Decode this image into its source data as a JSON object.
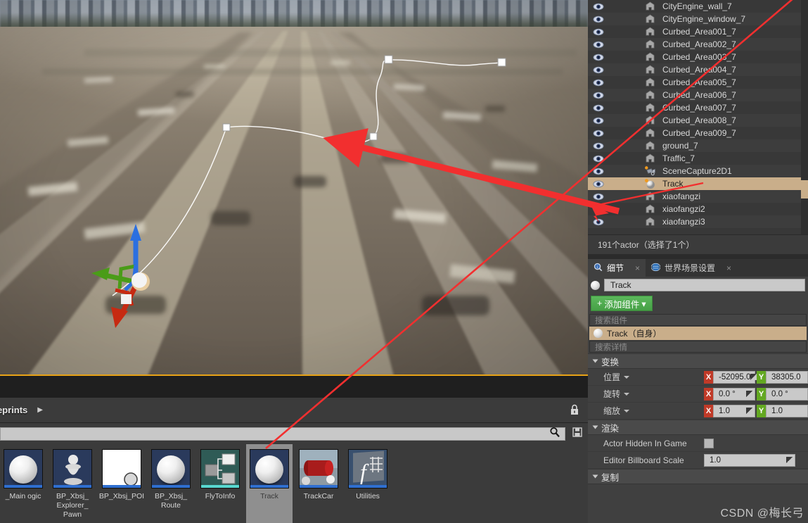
{
  "viewport": {
    "gizmo": {
      "name": "translate-gizmo",
      "axes": [
        "X",
        "Y",
        "Z"
      ]
    },
    "spline_points": 4,
    "selection_border_color": "#e8a317"
  },
  "bottom_toolbar": {
    "label": "ueprints",
    "arrow": "▶",
    "lock_icon": "lock-icon"
  },
  "content_browser": {
    "search_placeholder": "",
    "search_icon": "search-icon",
    "save_icon": "save-icon",
    "assets": [
      {
        "label": "_Main\nogic",
        "kind": "blueprint",
        "selected": false,
        "thumb": "sphere",
        "bg": "#2a3a5c",
        "stripe": "#2f6fd0"
      },
      {
        "label": "BP_Xbsj_\nExplorer_\nPawn",
        "kind": "blueprint",
        "selected": false,
        "thumb": "pawn",
        "bg": "#2a3a5c",
        "stripe": "#2f6fd0"
      },
      {
        "label": "BP_Xbsj_POI",
        "kind": "blueprint",
        "selected": false,
        "thumb": "white-sphere",
        "bg": "#ffffff",
        "stripe": "#2f6fd0"
      },
      {
        "label": "BP_Xbsj_\nRoute",
        "kind": "blueprint",
        "selected": false,
        "thumb": "sphere",
        "bg": "#2a3a5c",
        "stripe": "#2f6fd0"
      },
      {
        "label": "FlyToInfo",
        "kind": "struct",
        "selected": false,
        "thumb": "struct",
        "bg": "#2f5b56",
        "stripe": "#58d8d0"
      },
      {
        "label": "Track",
        "kind": "blueprint",
        "selected": true,
        "thumb": "sphere",
        "bg": "#2a3a5c",
        "stripe": "#2f6fd0"
      },
      {
        "label": "TrackCar",
        "kind": "blueprint",
        "selected": false,
        "thumb": "car",
        "bg": "#8c9aa6",
        "stripe": "#2f6fd0"
      },
      {
        "label": "Utilities",
        "kind": "function-library",
        "selected": false,
        "thumb": "function",
        "bg": "#39506e",
        "stripe": "#2f6fd0"
      }
    ]
  },
  "outliner": {
    "scrollbar": {
      "name": "outliner-scrollbar",
      "thumb_color": "#c9ae8a"
    },
    "rows": [
      {
        "name": "CityEngine_wall_7",
        "icon": "mesh-icon",
        "eye": "eye-icon",
        "selected": false
      },
      {
        "name": "CityEngine_window_7",
        "icon": "mesh-icon",
        "eye": "eye-icon",
        "selected": false
      },
      {
        "name": "Curbed_Area001_7",
        "icon": "mesh-icon",
        "eye": "eye-icon",
        "selected": false
      },
      {
        "name": "Curbed_Area002_7",
        "icon": "mesh-icon",
        "eye": "eye-icon",
        "selected": false
      },
      {
        "name": "Curbed_Area003_7",
        "icon": "mesh-icon",
        "eye": "eye-icon",
        "selected": false
      },
      {
        "name": "Curbed_Area004_7",
        "icon": "mesh-icon",
        "eye": "eye-icon",
        "selected": false
      },
      {
        "name": "Curbed_Area005_7",
        "icon": "mesh-icon",
        "eye": "eye-icon",
        "selected": false
      },
      {
        "name": "Curbed_Area006_7",
        "icon": "mesh-icon",
        "eye": "eye-icon",
        "selected": false
      },
      {
        "name": "Curbed_Area007_7",
        "icon": "mesh-icon",
        "eye": "eye-icon",
        "selected": false
      },
      {
        "name": "Curbed_Area008_7",
        "icon": "mesh-icon",
        "eye": "eye-icon",
        "selected": false
      },
      {
        "name": "Curbed_Area009_7",
        "icon": "mesh-icon",
        "eye": "eye-icon",
        "selected": false
      },
      {
        "name": "ground_7",
        "icon": "mesh-icon",
        "eye": "eye-icon",
        "selected": false
      },
      {
        "name": "Traffic_7",
        "icon": "mesh-icon",
        "eye": "eye-icon",
        "selected": false
      },
      {
        "name": "SceneCapture2D1",
        "icon": "scene-capture-icon",
        "eye": "eye-icon",
        "selected": false
      },
      {
        "name": "Track",
        "icon": "blueprint-sphere-icon",
        "eye": "eye-icon",
        "selected": true
      },
      {
        "name": "xiaofangzi",
        "icon": "mesh-icon",
        "eye": "eye-icon",
        "selected": false
      },
      {
        "name": "xiaofangzi2",
        "icon": "mesh-icon",
        "eye": "eye-icon",
        "selected": false
      },
      {
        "name": "xiaofangzi3",
        "icon": "mesh-icon",
        "eye": "eye-icon",
        "selected": false
      }
    ],
    "status": "191个actor（选择了1个）"
  },
  "details": {
    "tabs": [
      {
        "label": "细节",
        "icon": "details-search-icon",
        "active": true,
        "close": "×"
      },
      {
        "label": "世界场景设置",
        "icon": "world-icon",
        "active": false,
        "close": "×"
      }
    ],
    "actor_name": "Track",
    "add_component_label": "添加组件",
    "add_component_caret": "▾",
    "component_search_placeholder": "搜索组件",
    "component_row": "Track（自身）",
    "details_search_placeholder": "搜索详情",
    "sections": [
      {
        "title": "变换",
        "rows": [
          {
            "label": "位置",
            "type": "vector",
            "x": "-52095.0",
            "y": "38305.0"
          },
          {
            "label": "旋转",
            "type": "vector",
            "x": "0.0 °",
            "y": "0.0 °"
          },
          {
            "label": "缩放",
            "type": "vector",
            "x": "1.0",
            "y": "1.0"
          }
        ]
      },
      {
        "title": "渲染",
        "rows": [
          {
            "label": "Actor Hidden In Game",
            "type": "checkbox",
            "value": ""
          },
          {
            "label": "Editor Billboard Scale",
            "type": "text",
            "value": "1.0"
          }
        ]
      },
      {
        "title": "复制",
        "rows": []
      }
    ],
    "watermark": "CSDN @梅长弓"
  },
  "colors": {
    "selection_tan": "#c9ae8a",
    "axis_x": "#c03a28",
    "axis_y": "#63a821",
    "add_button_green": "#4fa84f",
    "annotation_red": "#f22f2f"
  }
}
